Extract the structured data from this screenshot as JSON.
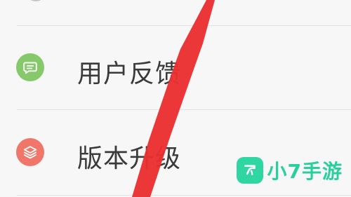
{
  "settings_menu": {
    "items": [
      {
        "label": "用户反馈",
        "icon": "message-icon",
        "icon_color": "#86c96a"
      },
      {
        "label": "版本升级",
        "icon": "layers-icon",
        "icon_color": "#ef7669"
      }
    ]
  },
  "watermark": {
    "text": "小7手游",
    "color": "#2fd6a2"
  },
  "annotation": {
    "stroke_color": "#ea2f2f"
  }
}
